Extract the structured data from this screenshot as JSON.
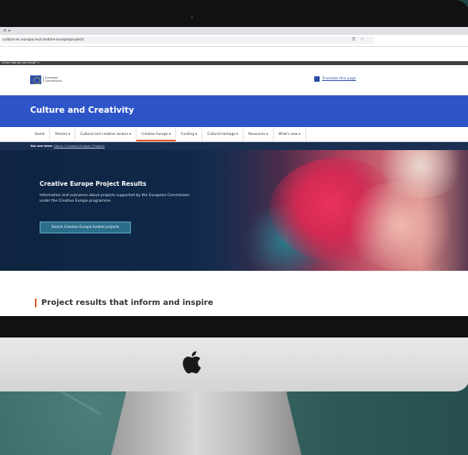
{
  "browser": {
    "tab_label": "✕  +",
    "url": "culture.ec.europa.eu/creative-europe/projects",
    "gov_bar_text": "Union  How do you know?  ∨"
  },
  "header": {
    "logo_text": "European Commission",
    "translate_label": "Translate this page"
  },
  "site": {
    "title": "Culture and Creativity"
  },
  "nav": {
    "items": [
      {
        "label": "Home"
      },
      {
        "label": "Policies ▾"
      },
      {
        "label": "Cultural and creative sectors ▾"
      },
      {
        "label": "Creative Europe ▾"
      },
      {
        "label": "Funding ▾"
      },
      {
        "label": "Cultural heritage ▾"
      },
      {
        "label": "Resources ▾"
      },
      {
        "label": "What's new ▾"
      }
    ],
    "active_index": 3
  },
  "breadcrumb": {
    "prefix": "You are here:",
    "trail": "Home / Creative Europe / Projects"
  },
  "hero": {
    "title": "Creative Europe Project Results",
    "description": "Information and outcomes about projects supported by the European Commission under the Creative Europe programme.",
    "button_label": "Search Creative Europe funded projects"
  },
  "main": {
    "section_title": "Project results that inform and inspire"
  },
  "colors": {
    "banner_blue": "#2d55c8",
    "accent_orange": "#e05a28",
    "hero_navy": "#0f2a47",
    "background_teal": "#2d5957"
  },
  "icons": [
    "apple-logo-icon",
    "translate-icon",
    "star-icon",
    "key-icon"
  ]
}
